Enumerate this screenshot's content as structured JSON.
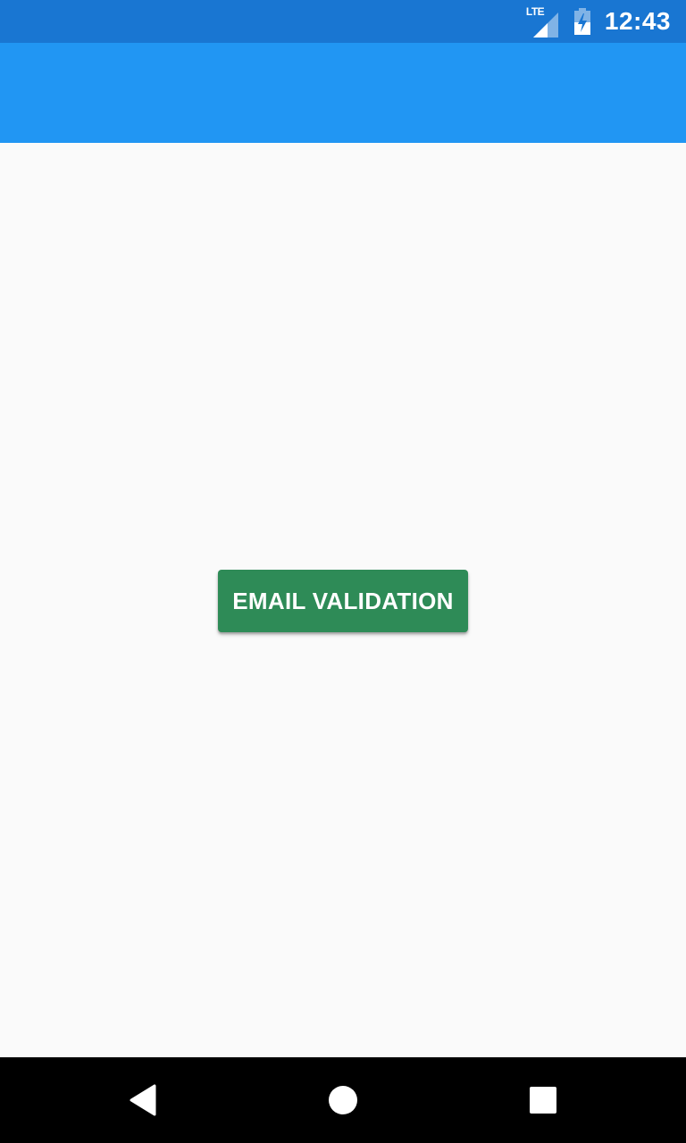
{
  "status_bar": {
    "network_label": "LTE",
    "time": "12:43",
    "icons": [
      "lte-signal-icon",
      "battery-charging-icon"
    ]
  },
  "main": {
    "button_label": "EMAIL VALIDATION"
  },
  "nav_bar": {
    "icons": [
      "back-icon",
      "home-icon",
      "recents-icon"
    ]
  },
  "colors": {
    "status_bar": "#1976d2",
    "app_bar": "#2196f3",
    "background": "#fafafa",
    "button": "#2e8b57",
    "nav_bar": "#000000"
  }
}
